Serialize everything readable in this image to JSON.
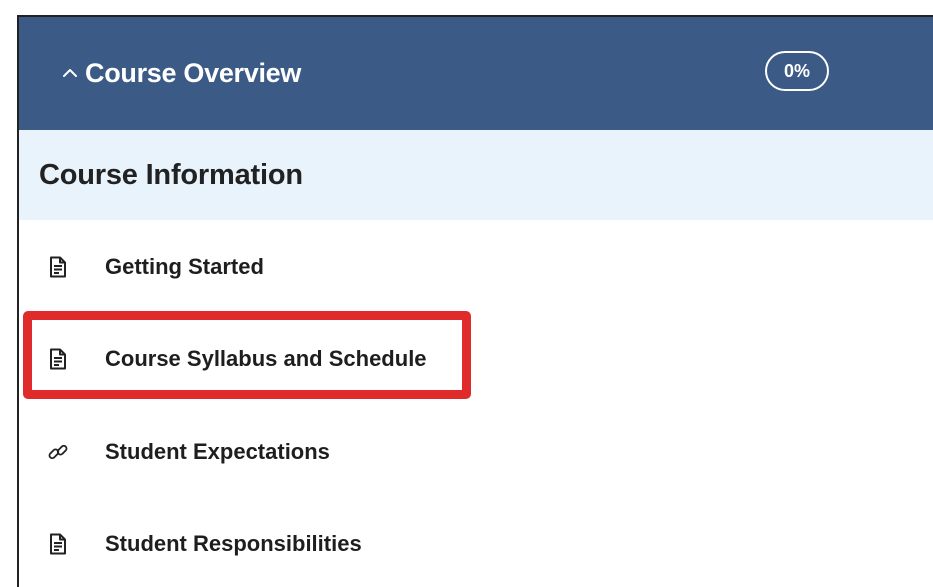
{
  "header": {
    "title": "Course Overview",
    "progress": "0%"
  },
  "section": {
    "title": "Course Information"
  },
  "items": [
    {
      "label": "Getting Started",
      "icon": "document-icon"
    },
    {
      "label": "Course Syllabus and Schedule",
      "icon": "document-icon"
    },
    {
      "label": "Student Expectations",
      "icon": "link-icon"
    },
    {
      "label": "Student Responsibilities",
      "icon": "document-icon"
    }
  ],
  "colors": {
    "header_bg": "#3b5a85",
    "section_bg": "#e9f3fc",
    "highlight": "#e02b2b"
  }
}
